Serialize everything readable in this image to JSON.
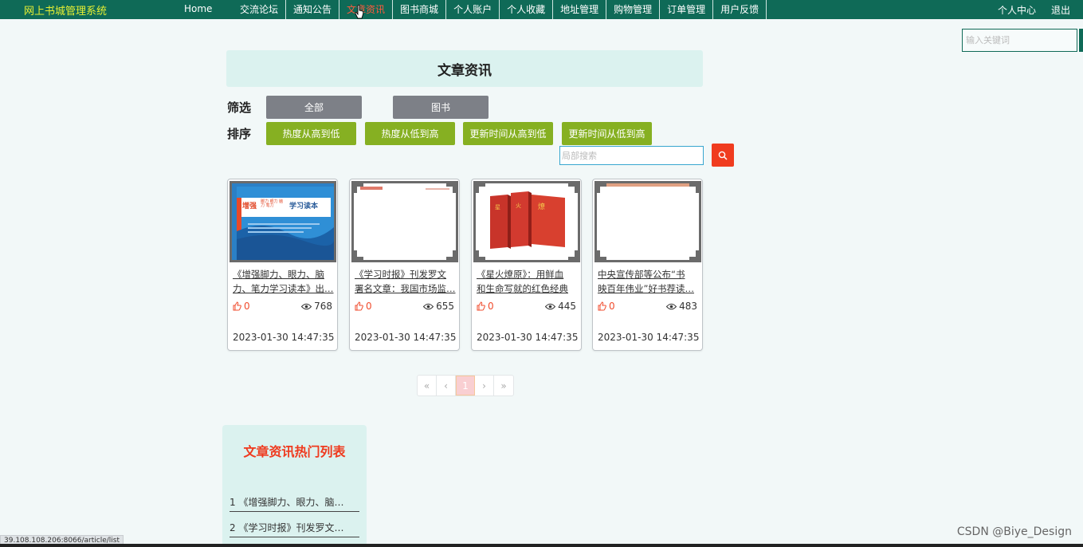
{
  "header": {
    "brand": "网上书城管理系统",
    "home": "Home",
    "nav": [
      "交流论坛",
      "通知公告",
      "文章资讯",
      "图书商城",
      "个人账户",
      "个人收藏",
      "地址管理",
      "购物管理",
      "订单管理",
      "用户反馈"
    ],
    "active_index": 2,
    "user_center": "个人中心",
    "logout": "退出"
  },
  "top_search": {
    "placeholder": "输入关键词"
  },
  "page_title": "文章资讯",
  "filter": {
    "label": "筛选",
    "options": [
      "全部",
      "图书"
    ]
  },
  "sort": {
    "label": "排序",
    "options": [
      "热度从高到低",
      "热度从低到高",
      "更新时间从高到低",
      "更新时间从低到高"
    ]
  },
  "local_search": {
    "placeholder": "局部搜索"
  },
  "articles": [
    {
      "title_line1": "《增强脚力、眼力、脑",
      "title_line2": "力、笔力学习读本》出…",
      "likes": "0",
      "views": "768",
      "date": "2023-01-30 14:47:35",
      "cover_text_main": "增强",
      "cover_text_sub": "学习读本",
      "cover_small": "脚力 眼力 脑力 笔力"
    },
    {
      "title_line1": "《学习时报》刊发罗文",
      "title_line2": "署名文章：我国市场监…",
      "likes": "0",
      "views": "655",
      "date": "2023-01-30 14:47:35"
    },
    {
      "title_line1": "《星火燎原》：用鲜血",
      "title_line2": "和生命写就的红色经典",
      "likes": "0",
      "views": "445",
      "date": "2023-01-30 14:47:35"
    },
    {
      "title_line1": "中央宣传部等公布“书",
      "title_line2": "映百年伟业”好书荐读…",
      "likes": "0",
      "views": "483",
      "date": "2023-01-30 14:47:35"
    }
  ],
  "pagination": {
    "first": "«",
    "prev": "‹",
    "current": "1",
    "next": "›",
    "last": "»"
  },
  "hot_list": {
    "title": "文章资讯热门列表",
    "items": [
      "1 《增强脚力、眼力、脑…",
      "2 《学习时报》刊发罗文…"
    ]
  },
  "status_url": "39.108.108.206:8066/article/list",
  "watermark": "CSDN @Biye_Design",
  "colors": {
    "nav_bg": "#0f6a57",
    "brand": "#e6ef33",
    "active_nav": "#ff5a3c",
    "sort_button": "#86b022",
    "filter_button": "#7d8087",
    "search_button": "#f03c1f",
    "banner_bg": "#dbf2ef"
  }
}
